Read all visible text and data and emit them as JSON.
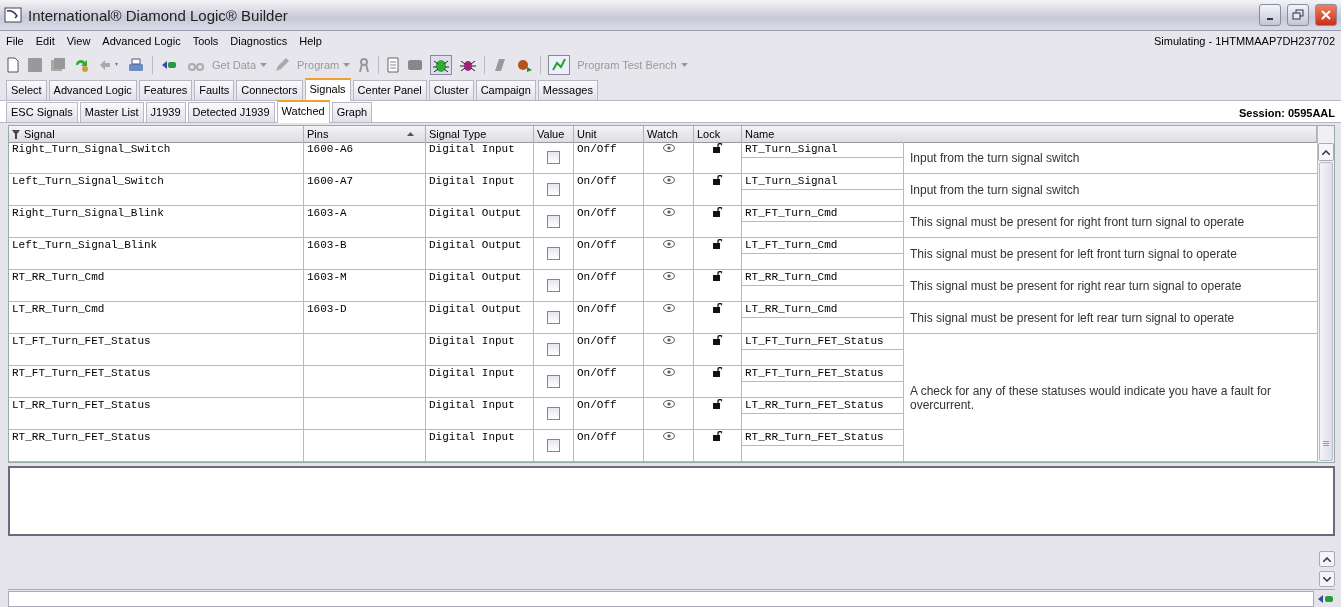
{
  "window": {
    "title": "International® Diamond Logic® Builder"
  },
  "menu": [
    "File",
    "Edit",
    "View",
    "Advanced Logic",
    "Tools",
    "Diagnostics",
    "Help"
  ],
  "status": "Simulating - 1HTMMAAP7DH237702",
  "toolbar": [
    {
      "label": "Get Data",
      "disabled": true,
      "dropdown": true
    },
    {
      "label": "Program",
      "disabled": true,
      "dropdown": true
    },
    {
      "label": "Program Test Bench",
      "disabled": true,
      "dropdown": true
    }
  ],
  "tabs": [
    {
      "label": "Select",
      "selected": false
    },
    {
      "label": "Advanced Logic",
      "selected": false
    },
    {
      "label": "Features",
      "selected": false
    },
    {
      "label": "Faults",
      "selected": false
    },
    {
      "label": "Connectors",
      "selected": false
    },
    {
      "label": "Signals",
      "selected": true
    },
    {
      "label": "Center Panel",
      "selected": false
    },
    {
      "label": "Cluster",
      "selected": false
    },
    {
      "label": "Campaign",
      "selected": false
    },
    {
      "label": "Messages",
      "selected": false
    }
  ],
  "subtabs": [
    {
      "label": "ESC Signals",
      "selected": false
    },
    {
      "label": "Master List",
      "selected": false
    },
    {
      "label": "J1939",
      "selected": false
    },
    {
      "label": "Detected J1939",
      "selected": false
    },
    {
      "label": "Watched",
      "selected": true
    },
    {
      "label": "Graph",
      "selected": false
    }
  ],
  "session": "Session: 0595AAL",
  "table": {
    "columns": [
      {
        "label": "Signal",
        "filter": true
      },
      {
        "label": "Pins",
        "sorted": true
      },
      {
        "label": "Signal Type"
      },
      {
        "label": "Value"
      },
      {
        "label": "Unit"
      },
      {
        "label": "Watch"
      },
      {
        "label": "Lock"
      },
      {
        "label": "Name"
      }
    ],
    "groups": [
      {
        "description": "Input from the turn signal switch",
        "rows": [
          {
            "signal": "Right_Turn_Signal_Switch",
            "pins": "1600-A6",
            "signal_type": "Digital Input",
            "checked": false,
            "unit": "On/Off",
            "name": "RT_Turn_Signal"
          }
        ]
      },
      {
        "description": "Input from the turn signal switch",
        "rows": [
          {
            "signal": "Left_Turn_Signal_Switch",
            "pins": "1600-A7",
            "signal_type": "Digital Input",
            "checked": false,
            "unit": "On/Off",
            "name": "LT_Turn_Signal"
          }
        ]
      },
      {
        "description": "This signal must be present for right front turn signal to operate",
        "rows": [
          {
            "signal": "Right_Turn_Signal_Blink",
            "pins": "1603-A",
            "signal_type": "Digital Output",
            "checked": false,
            "unit": "On/Off",
            "name": "RT_FT_Turn_Cmd"
          }
        ]
      },
      {
        "description": "This signal must be present for left front turn signal to operate",
        "rows": [
          {
            "signal": "Left_Turn_Signal_Blink",
            "pins": "1603-B",
            "signal_type": "Digital Output",
            "checked": false,
            "unit": "On/Off",
            "name": "LT_FT_Turn_Cmd"
          }
        ]
      },
      {
        "description": "This signal must be present for right rear turn signal to operate",
        "rows": [
          {
            "signal": "RT_RR_Turn_Cmd",
            "pins": "1603-M",
            "signal_type": "Digital Output",
            "checked": false,
            "unit": "On/Off",
            "name": "RT_RR_Turn_Cmd"
          }
        ]
      },
      {
        "description": "This signal must be present for left rear turn signal to operate",
        "rows": [
          {
            "signal": "LT_RR_Turn_Cmd",
            "pins": "1603-D",
            "signal_type": "Digital Output",
            "checked": false,
            "unit": "On/Off",
            "name": "LT_RR_Turn_Cmd"
          }
        ]
      },
      {
        "description": "A check for any of these statuses would indicate you have a fault for overcurrent.",
        "rows": [
          {
            "signal": "LT_FT_Turn_FET_Status",
            "signal_type": "Digital Input",
            "checked": false,
            "unit": "On/Off",
            "name": "LT_FT_Turn_FET_Status"
          },
          {
            "signal": "RT_FT_Turn_FET_Status",
            "signal_type": "Digital Input",
            "checked": false,
            "unit": "On/Off",
            "name": "RT_FT_Turn_FET_Status"
          },
          {
            "signal": "LT_RR_Turn_FET_Status",
            "signal_type": "Digital Input",
            "checked": false,
            "unit": "On/Off",
            "name": "LT_RR_Turn_FET_Status"
          },
          {
            "signal": "RT_RR_Turn_FET_Status",
            "signal_type": "Digital Input",
            "checked": false,
            "unit": "On/Off",
            "name": "RT_RR_Turn_FET_Status"
          }
        ]
      }
    ]
  }
}
